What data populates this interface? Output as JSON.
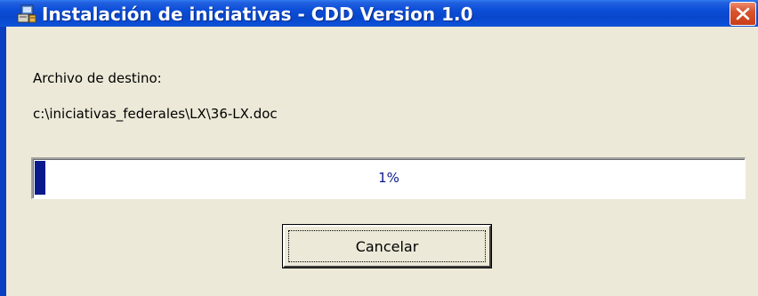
{
  "window": {
    "title": "Instalación de iniciativas - CDD Version 1.0",
    "title_icon": "installer-icon",
    "close_icon": "close-icon"
  },
  "labels": {
    "destination_caption": "Archivo de destino:",
    "destination_path": "c:\\iniciativas_federales\\LX\\36-LX.doc"
  },
  "progress": {
    "percent": 1,
    "text": "1%",
    "fill_color": "#0a1a8c"
  },
  "buttons": {
    "cancel_label": "Cancelar"
  },
  "colors": {
    "titlebar": "#0847cc",
    "client_background": "#ece9d8",
    "close_button": "#d8542f"
  }
}
